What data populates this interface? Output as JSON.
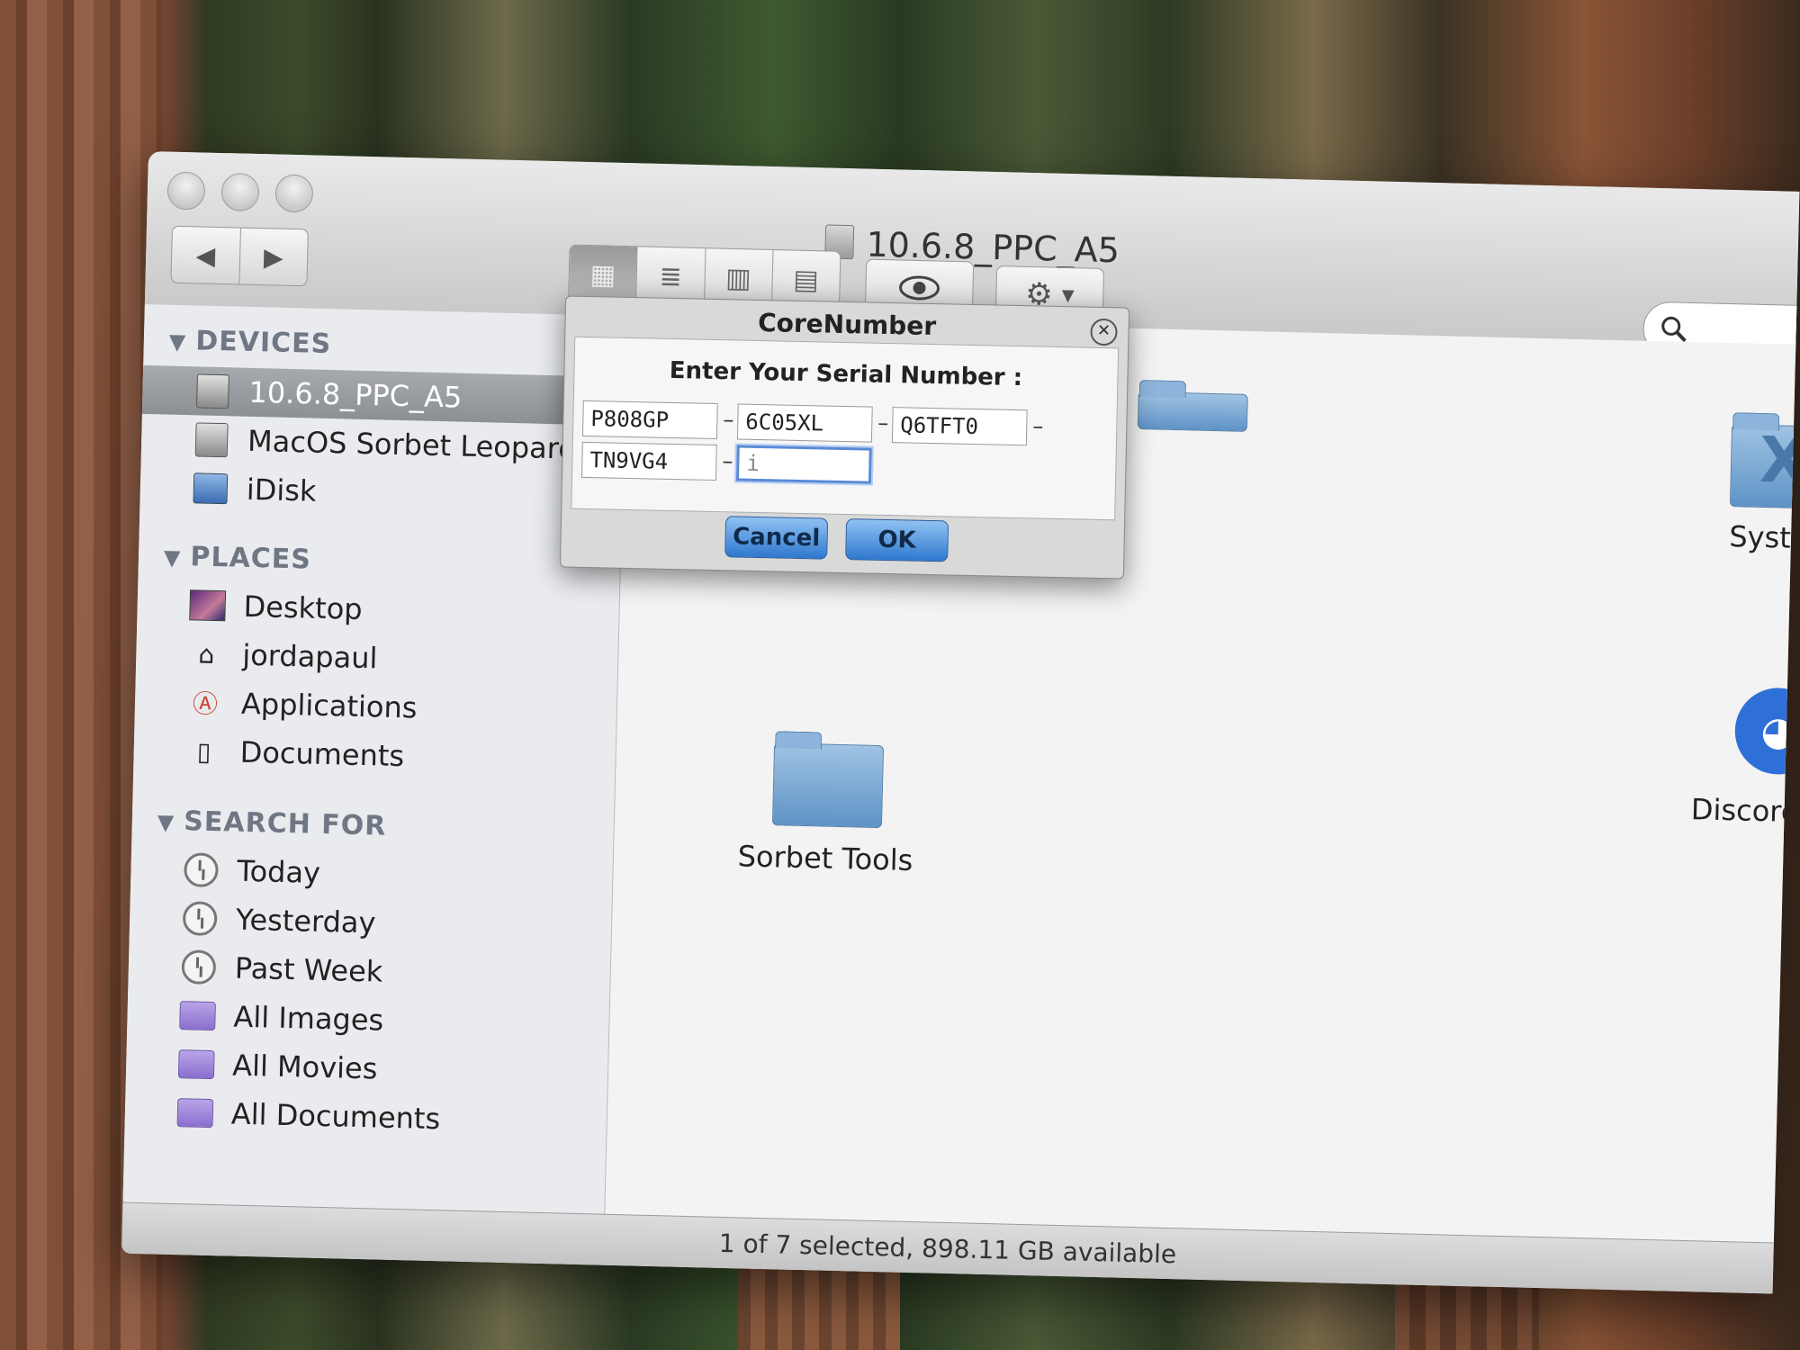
{
  "window": {
    "title": "10.6.8_PPC_A5"
  },
  "toolbar": {
    "back_icon": "◀",
    "forward_icon": "▶",
    "view_icons": [
      "▦",
      "≣",
      "▥",
      "▤"
    ],
    "quicklook_icon": "eye-icon",
    "gear_icon": "gear-icon",
    "search_icon": "search-icon"
  },
  "sidebar": {
    "devices_label": "DEVICES",
    "places_label": "PLACES",
    "search_label": "SEARCH FOR",
    "devices": [
      {
        "label": "10.6.8_PPC_A5",
        "selected": true
      },
      {
        "label": "MacOS Sorbet Leopard"
      },
      {
        "label": "iDisk"
      }
    ],
    "places": [
      {
        "label": "Desktop"
      },
      {
        "label": "jordapaul"
      },
      {
        "label": "Applications"
      },
      {
        "label": "Documents"
      }
    ],
    "search": [
      {
        "label": "Today"
      },
      {
        "label": "Yesterday"
      },
      {
        "label": "Past Week"
      },
      {
        "label": "All Images"
      },
      {
        "label": "All Movies"
      },
      {
        "label": "All Documents"
      }
    ]
  },
  "content": {
    "items": [
      {
        "label": "System"
      },
      {
        "label": "Discord Lite"
      },
      {
        "label": "Sorbet Tools"
      }
    ]
  },
  "status": {
    "text": "1 of 7 selected, 898.11 GB available"
  },
  "dialog": {
    "title": "CoreNumber",
    "prompt": "Enter Your Serial Number :",
    "fields": [
      "P808GP",
      "6C05XL",
      "Q6TFT0",
      "TN9VG4",
      "i"
    ],
    "cancel_label": "Cancel",
    "ok_label": "OK"
  }
}
